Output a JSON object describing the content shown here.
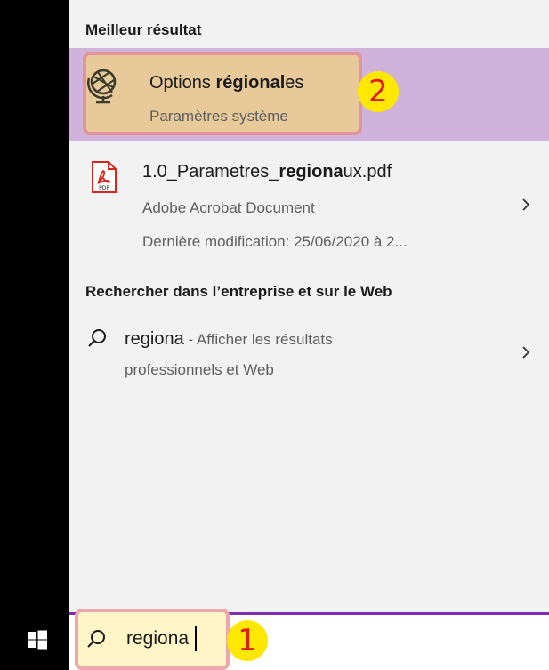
{
  "colors": {
    "taskbar": "#000000",
    "panel_bg": "#f2f2f2",
    "selected_row": "#cfb3db",
    "highlight_fill": "#e7c99a",
    "highlight_border": "#e4939b",
    "badge": "#ffe800",
    "badge_text": "#e01d1d",
    "search_accent": "#7b2fb3",
    "pdf_red": "#d7261e"
  },
  "best_match": {
    "header": "Meilleur résultat",
    "item": {
      "icon": "globe-icon",
      "title_pre": "Options ",
      "title_bold": "régional",
      "title_post": "es",
      "subtitle": "Paramètres système",
      "badge": "2"
    }
  },
  "results": [
    {
      "icon": "pdf-icon",
      "icon_label": "PDF",
      "title_pre": "1.0_Parametres_",
      "title_bold": "regiona",
      "title_post": "ux.pdf",
      "subtitle": "Adobe Acrobat Document",
      "detail": "Dernière modification: 25/06/2020 à 2..."
    }
  ],
  "web_section": {
    "header": "Rechercher dans l’entreprise et sur le Web",
    "item": {
      "icon": "search-icon",
      "query": "regiona",
      "text_line1": " - Afficher les résultats",
      "text_line2": "professionnels et Web"
    }
  },
  "search": {
    "icon": "search-icon",
    "value": "regiona",
    "badge": "1"
  },
  "taskbar": {
    "start_icon": "windows-logo-icon"
  }
}
